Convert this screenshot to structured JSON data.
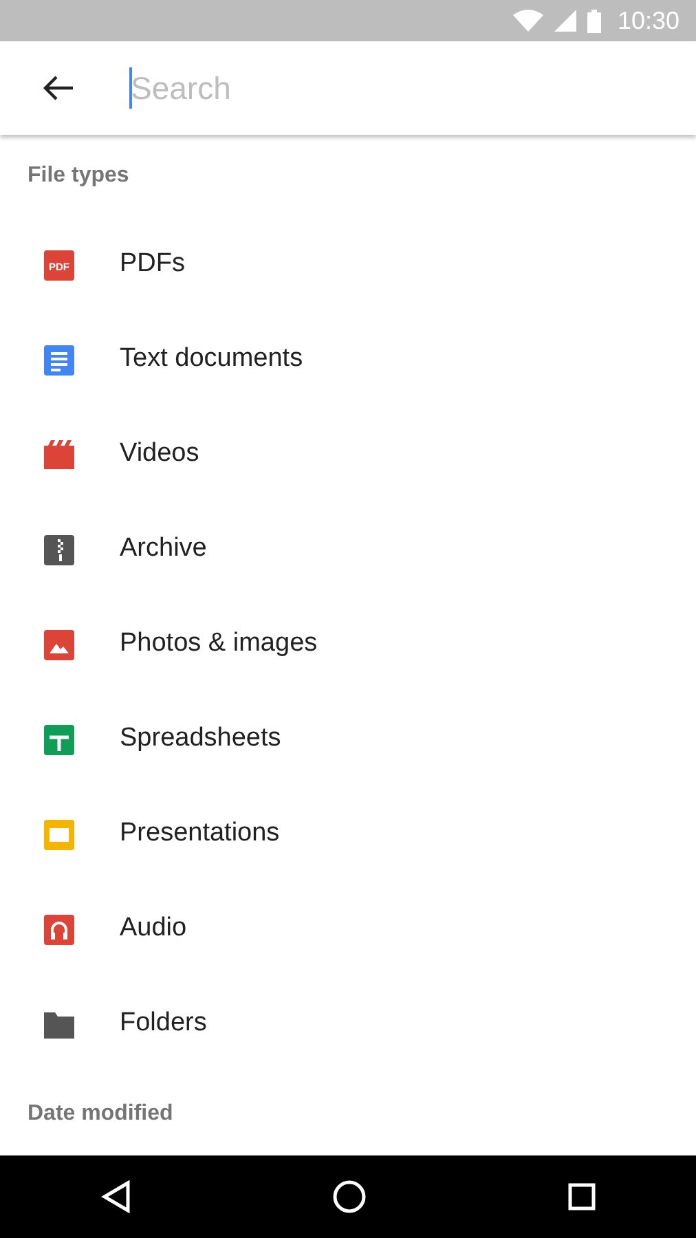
{
  "status_bar": {
    "time": "10:30"
  },
  "search": {
    "placeholder": "Search",
    "focused": true
  },
  "sections": [
    {
      "title": "File types",
      "items": [
        {
          "label": "PDFs",
          "kind": "pdf",
          "icon_text": "PDF"
        },
        {
          "label": "Text documents",
          "kind": "doc"
        },
        {
          "label": "Videos",
          "kind": "video"
        },
        {
          "label": "Archive",
          "kind": "archive"
        },
        {
          "label": "Photos & images",
          "kind": "image"
        },
        {
          "label": "Spreadsheets",
          "kind": "sheet"
        },
        {
          "label": "Presentations",
          "kind": "slides"
        },
        {
          "label": "Audio",
          "kind": "audio"
        },
        {
          "label": "Folders",
          "kind": "folder"
        }
      ]
    },
    {
      "title": "Date modified"
    }
  ]
}
